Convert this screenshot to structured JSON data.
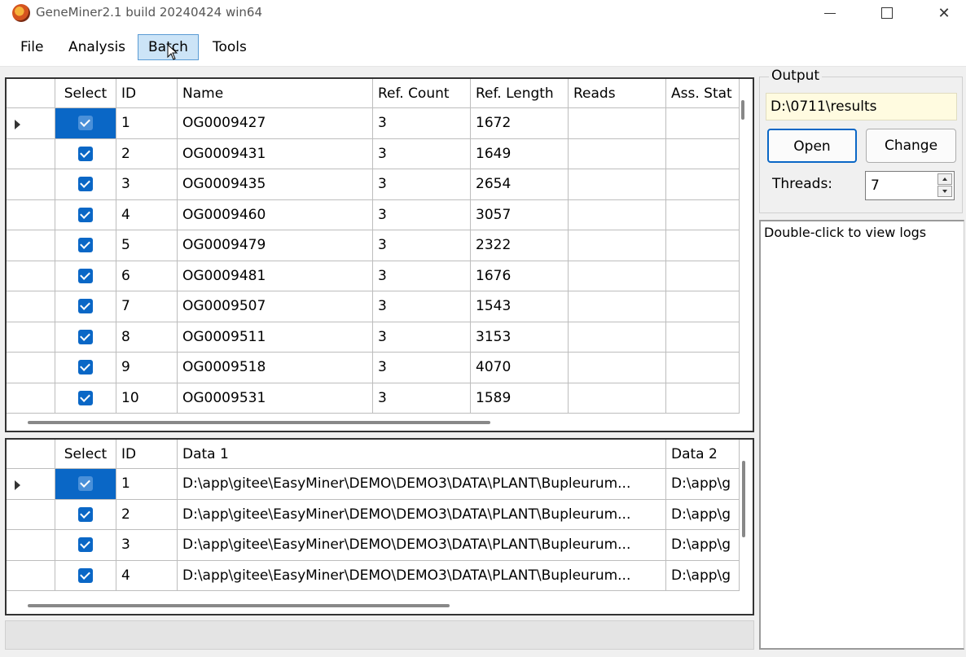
{
  "window": {
    "title": "GeneMiner2.1 build 20240424 win64"
  },
  "menu": [
    {
      "label": "File"
    },
    {
      "label": "Analysis"
    },
    {
      "label": "Batch",
      "active": true
    },
    {
      "label": "Tools"
    }
  ],
  "genes_table": {
    "headers": [
      "Select",
      "ID",
      "Name",
      "Ref. Count",
      "Ref. Length",
      "Reads",
      "Ass. Stat"
    ],
    "rows": [
      {
        "id": "1",
        "name": "OG0009427",
        "ref_count": "3",
        "ref_length": "1672",
        "checked": true
      },
      {
        "id": "2",
        "name": "OG0009431",
        "ref_count": "3",
        "ref_length": "1649",
        "checked": true
      },
      {
        "id": "3",
        "name": "OG0009435",
        "ref_count": "3",
        "ref_length": "2654",
        "checked": true
      },
      {
        "id": "4",
        "name": "OG0009460",
        "ref_count": "3",
        "ref_length": "3057",
        "checked": true
      },
      {
        "id": "5",
        "name": "OG0009479",
        "ref_count": "3",
        "ref_length": "2322",
        "checked": true
      },
      {
        "id": "6",
        "name": "OG0009481",
        "ref_count": "3",
        "ref_length": "1676",
        "checked": true
      },
      {
        "id": "7",
        "name": "OG0009507",
        "ref_count": "3",
        "ref_length": "1543",
        "checked": true
      },
      {
        "id": "8",
        "name": "OG0009511",
        "ref_count": "3",
        "ref_length": "3153",
        "checked": true
      },
      {
        "id": "9",
        "name": "OG0009518",
        "ref_count": "3",
        "ref_length": "4070",
        "checked": true
      },
      {
        "id": "10",
        "name": "OG0009531",
        "ref_count": "3",
        "ref_length": "1589",
        "checked": true
      }
    ]
  },
  "data_table": {
    "headers": [
      "Select",
      "ID",
      "Data 1",
      "Data 2"
    ],
    "rows": [
      {
        "id": "1",
        "data1": "D:\\app\\gitee\\EasyMiner\\DEMO\\DEMO3\\DATA\\PLANT\\Bupleurum...",
        "data2": "D:\\app\\g",
        "checked": true
      },
      {
        "id": "2",
        "data1": "D:\\app\\gitee\\EasyMiner\\DEMO\\DEMO3\\DATA\\PLANT\\Bupleurum...",
        "data2": "D:\\app\\g",
        "checked": true
      },
      {
        "id": "3",
        "data1": "D:\\app\\gitee\\EasyMiner\\DEMO\\DEMO3\\DATA\\PLANT\\Bupleurum...",
        "data2": "D:\\app\\g",
        "checked": true
      },
      {
        "id": "4",
        "data1": "D:\\app\\gitee\\EasyMiner\\DEMO\\DEMO3\\DATA\\PLANT\\Bupleurum...",
        "data2": "D:\\app\\g",
        "checked": true
      }
    ]
  },
  "output": {
    "title": "Output",
    "path": "D:\\0711\\results",
    "open_label": "Open",
    "change_label": "Change",
    "threads_label": "Threads:",
    "threads_value": "7"
  },
  "log": {
    "hint": "Double-click to view logs"
  },
  "colors": {
    "accent": "#0a67c6",
    "menu_active": "#cce4f7",
    "path_bg": "#fffbe0"
  }
}
